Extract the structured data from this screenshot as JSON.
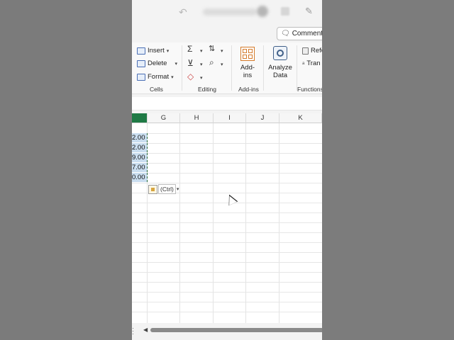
{
  "comments": {
    "label": "Comments"
  },
  "ribbon": {
    "cells": {
      "insert": "Insert",
      "delete": "Delete",
      "format": "Format",
      "label": "Cells"
    },
    "editing": {
      "label": "Editing"
    },
    "addins": {
      "button": "Add-ins",
      "label": "Add-ins"
    },
    "analyze": {
      "line1": "Analyze",
      "line2": "Data"
    },
    "functions": {
      "ref": "Refe",
      "tran": "Tran",
      "label": "Functions"
    }
  },
  "columns": [
    "G",
    "H",
    "I",
    "J",
    "K"
  ],
  "partial_column": "",
  "selected_values": [
    "2.00",
    "2.00",
    "9.00",
    "7.00",
    "0.00"
  ],
  "paste_options": {
    "ctrl": "(Ctrl)"
  }
}
